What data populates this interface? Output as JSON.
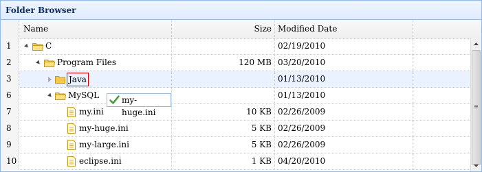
{
  "panel": {
    "title": "Folder Browser"
  },
  "columns": {
    "name": "Name",
    "size": "Size",
    "modified": "Modified Date"
  },
  "rows": [
    {
      "num": "1",
      "name": "C",
      "size": "",
      "date": "02/19/2010",
      "type": "folder",
      "state": "open"
    },
    {
      "num": "2",
      "name": "Program Files",
      "size": "120 MB",
      "date": "03/20/2010",
      "type": "folder",
      "state": "open"
    },
    {
      "num": "3",
      "name": "Java",
      "size": "",
      "date": "01/13/2010",
      "type": "folder",
      "state": "closed"
    },
    {
      "num": "6",
      "name": "MySQL",
      "size": "",
      "date": "01/13/2010",
      "type": "folder",
      "state": "open"
    },
    {
      "num": "7",
      "name": "my.ini",
      "size": "10 KB",
      "date": "02/26/2009",
      "type": "file"
    },
    {
      "num": "8",
      "name": "my-huge.ini",
      "size": "5 KB",
      "date": "02/26/2009",
      "type": "file"
    },
    {
      "num": "9",
      "name": "my-large.ini",
      "size": "5 KB",
      "date": "02/26/2009",
      "type": "file"
    },
    {
      "num": "10",
      "name": "eclipse.ini",
      "size": "1 KB",
      "date": "04/20/2010",
      "type": "file"
    }
  ],
  "drag_proxy": {
    "label": "my-huge.ini",
    "icon": "checkmark-icon"
  },
  "colors": {
    "border": "#95b8e7",
    "selected": "#eaf2ff",
    "folder": "#f5c945",
    "check": "#3a9a2a"
  }
}
